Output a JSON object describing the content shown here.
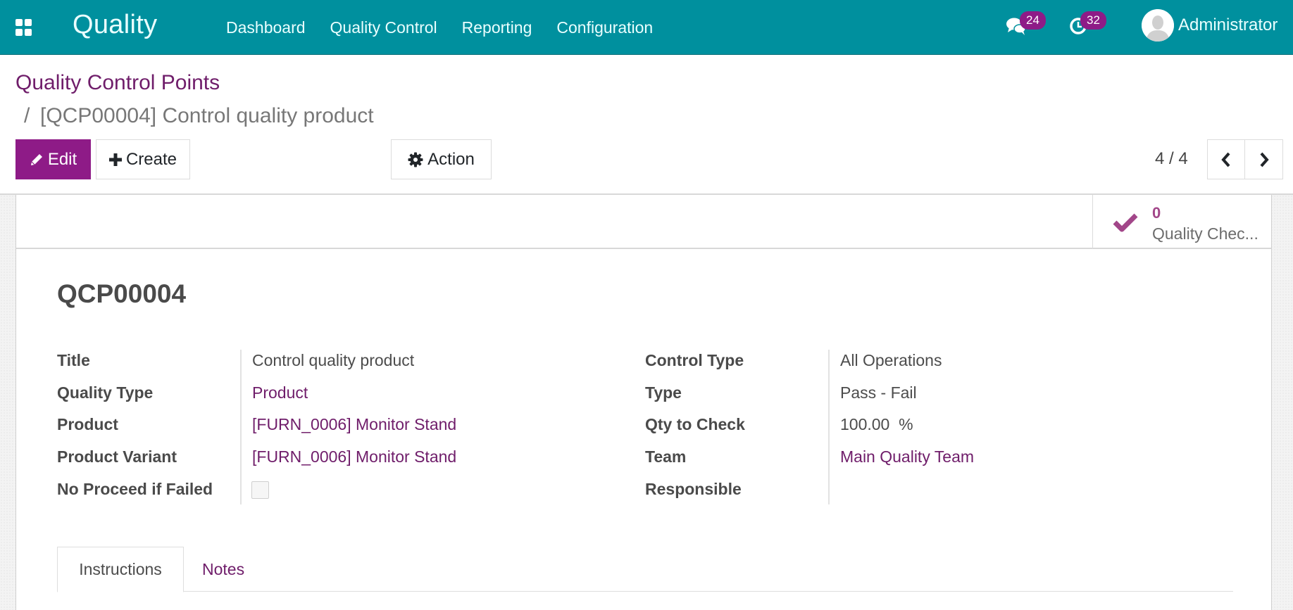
{
  "colors": {
    "topbar": "#00909e",
    "brand": "#8e1b87",
    "link": "#6f1d6a",
    "stat_icon": "#a24689"
  },
  "topbar": {
    "apps_icon": "apps-grid-icon",
    "app_title": "Quality",
    "menu": [
      "Dashboard",
      "Quality Control",
      "Reporting",
      "Configuration"
    ],
    "messages_icon": "chat-bubbles-icon",
    "messages_count": "24",
    "activities_icon": "clock-icon",
    "activities_count": "32",
    "user_avatar_icon": "user-avatar-icon",
    "user_name": "Administrator"
  },
  "breadcrumb": {
    "parent": "Quality Control Points",
    "separator": "/",
    "current": "[QCP00004] Control quality product"
  },
  "toolbar": {
    "edit_label": "Edit",
    "edit_icon": "pencil-icon",
    "create_label": "Create",
    "create_icon": "plus-icon",
    "action_label": "Action",
    "action_icon": "gear-icon"
  },
  "pager": {
    "value": "4 / 4",
    "prev_icon": "chevron-left-icon",
    "next_icon": "chevron-right-icon"
  },
  "stat_button": {
    "icon": "check-icon",
    "value": "0",
    "label": "Quality Chec..."
  },
  "record": {
    "title": "QCP00004",
    "left_fields": [
      {
        "label": "Title",
        "value": "Control quality product",
        "type": "text"
      },
      {
        "label": "Quality Type",
        "value": "Product",
        "type": "link"
      },
      {
        "label": "Product",
        "value": "[FURN_0006] Monitor Stand",
        "type": "link"
      },
      {
        "label": "Product Variant",
        "value": "[FURN_0006] Monitor Stand",
        "type": "link"
      },
      {
        "label": "No Proceed if Failed",
        "value": false,
        "type": "checkbox"
      }
    ],
    "right_fields": [
      {
        "label": "Control Type",
        "value": "All Operations",
        "type": "text"
      },
      {
        "label": "Type",
        "value": "Pass - Fail",
        "type": "text"
      },
      {
        "label": "Qty to Check",
        "value": "100.00  %",
        "type": "text"
      },
      {
        "label": "Team",
        "value": "Main Quality Team",
        "type": "link"
      },
      {
        "label": "Responsible",
        "value": "",
        "type": "text"
      }
    ]
  },
  "tabs": [
    {
      "label": "Instructions",
      "active": true
    },
    {
      "label": "Notes",
      "active": false
    }
  ]
}
